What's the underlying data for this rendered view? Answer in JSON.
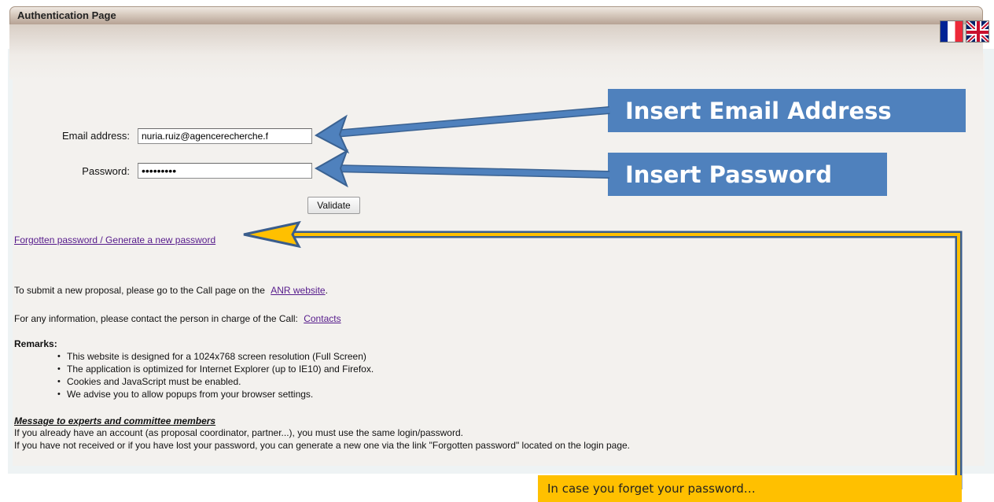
{
  "header": {
    "title": "Authentication Page"
  },
  "languages": [
    {
      "name": "French",
      "icon": "flag-fr-icon"
    },
    {
      "name": "English",
      "icon": "flag-uk-icon"
    }
  ],
  "form": {
    "email_label": "Email address:",
    "email_value": "nuria.ruiz@agencerecherche.f",
    "password_label": "Password:",
    "password_value": "•••••••••",
    "validate_label": "Validate"
  },
  "forgotten_link": "Forgotten password / Generate a new password",
  "info": {
    "proposal_text": "To submit a new proposal, please go to the Call page on the",
    "proposal_link": "ANR website",
    "proposal_end": ".",
    "contact_text": "For any information, please contact the person in charge of the Call:",
    "contact_link": "Contacts"
  },
  "remarks": {
    "title": "Remarks:",
    "items": [
      "This website is designed for a 1024x768 screen resolution (Full Screen)",
      "The application is optimized for Internet Explorer (up to IE10) and Firefox.",
      "Cookies and JavaScript must be enabled.",
      "We advise you to allow popups from your browser settings."
    ]
  },
  "message": {
    "title": "Message to experts and committee members",
    "line1": "If you already have an account (as proposal coordinator, partner...), you must use the same login/password.",
    "line2": "If you have not received or if you have lost your password, you can generate a new one via the link \"Forgotten password\" located on the login page."
  },
  "annotations": {
    "email_callout": "Insert Email Address",
    "password_callout": "Insert Password",
    "forgot_callout": "In case you forget your password…"
  },
  "colors": {
    "callout_blue": "#4f81bd",
    "callout_yellow": "#ffc000",
    "link_purple": "#551a8b"
  }
}
